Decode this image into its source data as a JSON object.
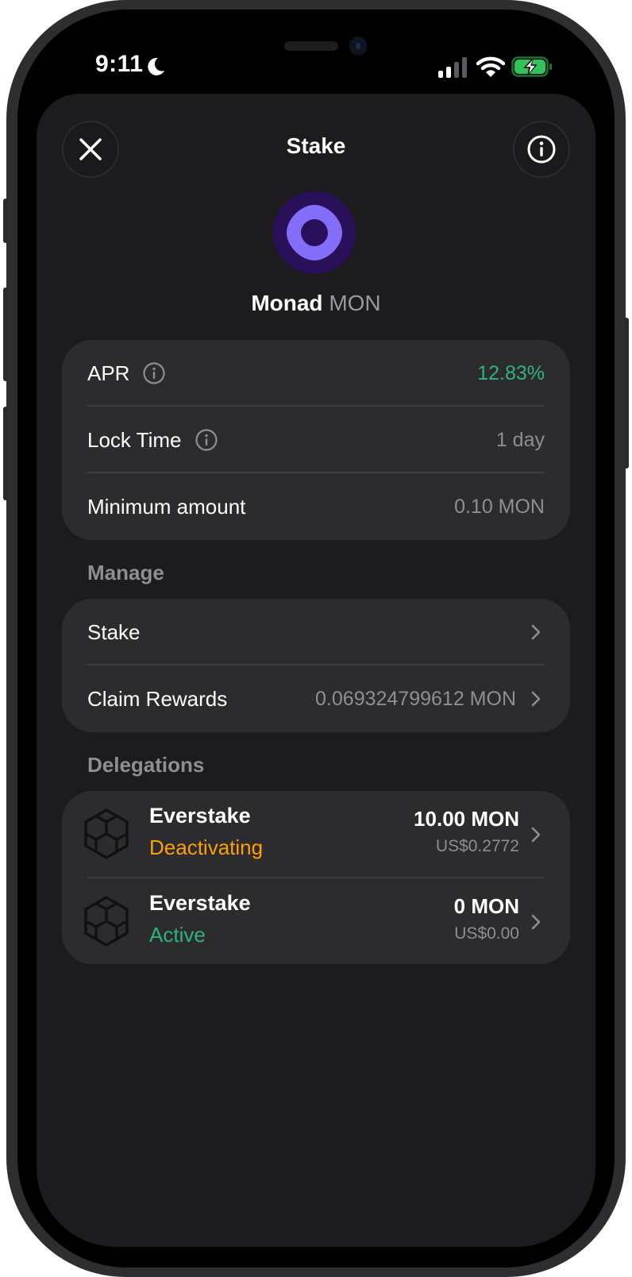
{
  "status_bar": {
    "time": "9:11"
  },
  "header": {
    "title": "Stake"
  },
  "coin": {
    "name": "Monad",
    "symbol": "MON"
  },
  "info_card": {
    "rows": [
      {
        "label": "APR",
        "value": "12.83%"
      },
      {
        "label": "Lock Time",
        "value": "1 day"
      },
      {
        "label": "Minimum amount",
        "value": "0.10 MON"
      }
    ]
  },
  "manage": {
    "heading": "Manage",
    "stake_label": "Stake",
    "claim_label": "Claim Rewards",
    "claim_value": "0.069324799612 MON"
  },
  "delegations": {
    "heading": "Delegations",
    "items": [
      {
        "validator": "Everstake",
        "status": "Deactivating",
        "amount": "10.00 MON",
        "fiat": "US$0.2772",
        "status_color": "#ff9f0a"
      },
      {
        "validator": "Everstake",
        "status": "Active",
        "amount": "0 MON",
        "fiat": "US$0.00",
        "status_color": "#2fb37a"
      }
    ]
  },
  "colors": {
    "accent_green": "#2fb37a",
    "warning_orange": "#ff9f0a",
    "coin_purple": "#836ef9"
  }
}
